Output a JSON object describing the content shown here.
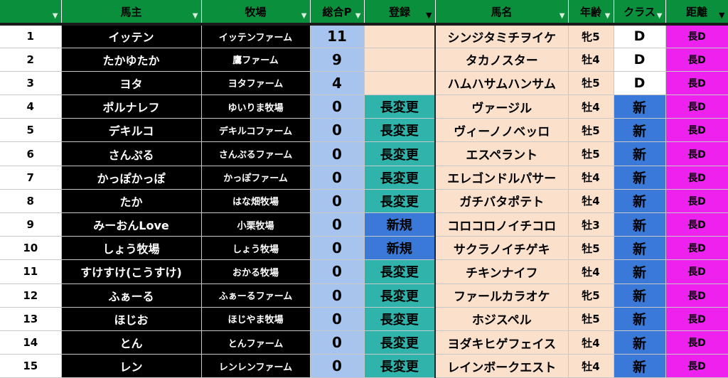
{
  "headers": {
    "num": "",
    "owner": "馬主",
    "farm": "牧場",
    "points": "総合P",
    "registration": "登録",
    "horse": "馬名",
    "age": "年齢",
    "class": "クラス",
    "distance": "距離"
  },
  "rows": [
    {
      "num": "1",
      "owner": "イッテン",
      "farm": "イッテンファーム",
      "points": "11",
      "registration": "",
      "horse": "シンジタミチヲイケ",
      "age": "牝5",
      "class": "D",
      "distance": "長D"
    },
    {
      "num": "2",
      "owner": "たかゆたか",
      "farm": "鷹ファーム",
      "points": "9",
      "registration": "",
      "horse": "タカノスター",
      "age": "牡4",
      "class": "D",
      "distance": "長D"
    },
    {
      "num": "3",
      "owner": "ヨタ",
      "farm": "ヨタファーム",
      "points": "4",
      "registration": "",
      "horse": "ハムハサムハンサム",
      "age": "牡5",
      "class": "D",
      "distance": "長D"
    },
    {
      "num": "4",
      "owner": "ポルナレフ",
      "farm": "ゆいりま牧場",
      "points": "0",
      "registration": "長変更",
      "horse": "ヴァージル",
      "age": "牡4",
      "class": "新",
      "distance": "長D"
    },
    {
      "num": "5",
      "owner": "デキルコ",
      "farm": "デキルコファーム",
      "points": "0",
      "registration": "長変更",
      "horse": "ヴィーノノベッロ",
      "age": "牡5",
      "class": "新",
      "distance": "長D"
    },
    {
      "num": "6",
      "owner": "さんぷる",
      "farm": "さんぷるファーム",
      "points": "0",
      "registration": "長変更",
      "horse": "エスペラント",
      "age": "牡5",
      "class": "新",
      "distance": "長D"
    },
    {
      "num": "7",
      "owner": "かっぽかっぽ",
      "farm": "かっぽファーム",
      "points": "0",
      "registration": "長変更",
      "horse": "エレゴンドルパサー",
      "age": "牡4",
      "class": "新",
      "distance": "長D"
    },
    {
      "num": "8",
      "owner": "たか",
      "farm": "はな畑牧場",
      "points": "0",
      "registration": "長変更",
      "horse": "ガチバタポテト",
      "age": "牡4",
      "class": "新",
      "distance": "長D"
    },
    {
      "num": "9",
      "owner": "みーおんLove",
      "farm": "小栗牧場",
      "points": "0",
      "registration": "新規",
      "horse": "コロコロノイチコロ",
      "age": "牡3",
      "class": "新",
      "distance": "長D"
    },
    {
      "num": "10",
      "owner": "しょう牧場",
      "farm": "しょう牧場",
      "points": "0",
      "registration": "新規",
      "horse": "サクラノイチゲキ",
      "age": "牡5",
      "class": "新",
      "distance": "長D"
    },
    {
      "num": "11",
      "owner": "すけすけ(こうすけ)",
      "farm": "おかる牧場",
      "points": "0",
      "registration": "長変更",
      "horse": "チキンナイフ",
      "age": "牡4",
      "class": "新",
      "distance": "長D"
    },
    {
      "num": "12",
      "owner": "ふぁーる",
      "farm": "ふぁーるファーム",
      "points": "0",
      "registration": "長変更",
      "horse": "ファールカラオケ",
      "age": "牝5",
      "class": "新",
      "distance": "長D"
    },
    {
      "num": "13",
      "owner": "ほじお",
      "farm": "ほじやま牧場",
      "points": "0",
      "registration": "長変更",
      "horse": "ホジスペル",
      "age": "牡5",
      "class": "新",
      "distance": "長D"
    },
    {
      "num": "14",
      "owner": "とん",
      "farm": "とんファーム",
      "points": "0",
      "registration": "長変更",
      "horse": "ヨダキヒゲフェイス",
      "age": "牡4",
      "class": "新",
      "distance": "長D"
    },
    {
      "num": "15",
      "owner": "レン",
      "farm": "レンレンファーム",
      "points": "0",
      "registration": "長変更",
      "horse": "レインボークエスト",
      "age": "牡4",
      "class": "新",
      "distance": "長D"
    }
  ],
  "colors": {
    "header_bg": "#0a8f3c",
    "owner_bg": "#000000",
    "points_bg": "#a7c4ef",
    "reg_change_bg": "#2fb3ab",
    "reg_new_bg": "#3a79d8",
    "horse_bg": "#fbe0cc",
    "class_new_bg": "#3a79d8",
    "distance_bg": "#ee22ee"
  },
  "icons": {
    "filter": "filter-dropdown-icon",
    "filter_active": "filter-active-icon"
  }
}
